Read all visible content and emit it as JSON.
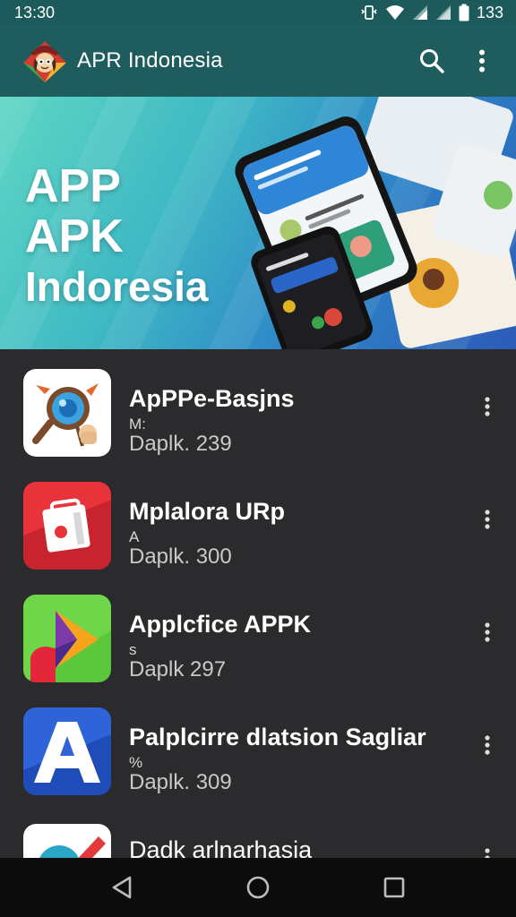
{
  "status": {
    "time": "13:30",
    "battery": "133"
  },
  "header": {
    "title": "APR Indonesia"
  },
  "banner": {
    "line1": "APP",
    "line2": "APK",
    "line3": "Indoresia"
  },
  "apps": [
    {
      "name": "ApPPe-Basjns",
      "sub": "M:",
      "meta": "Daplk. 239"
    },
    {
      "name": "Mplalora URp",
      "sub": "A",
      "meta": "Daplk. 300"
    },
    {
      "name": "Applcfice APPK",
      "sub": "s",
      "meta": "Daplk 297"
    },
    {
      "name": "Palplcirre dǀatsion Sagliar",
      "sub": "%",
      "meta": "Daplk. 309"
    },
    {
      "name": "Dadk arlnarhasia",
      "sub": "",
      "meta": ""
    }
  ],
  "icons": {
    "search": "search-icon",
    "more": "more-vert-icon",
    "back": "back-icon",
    "home": "home-icon",
    "recents": "recents-icon"
  },
  "colors": {
    "app_bar": "#1e5c5e",
    "list_bg": "#2b2b2d"
  }
}
